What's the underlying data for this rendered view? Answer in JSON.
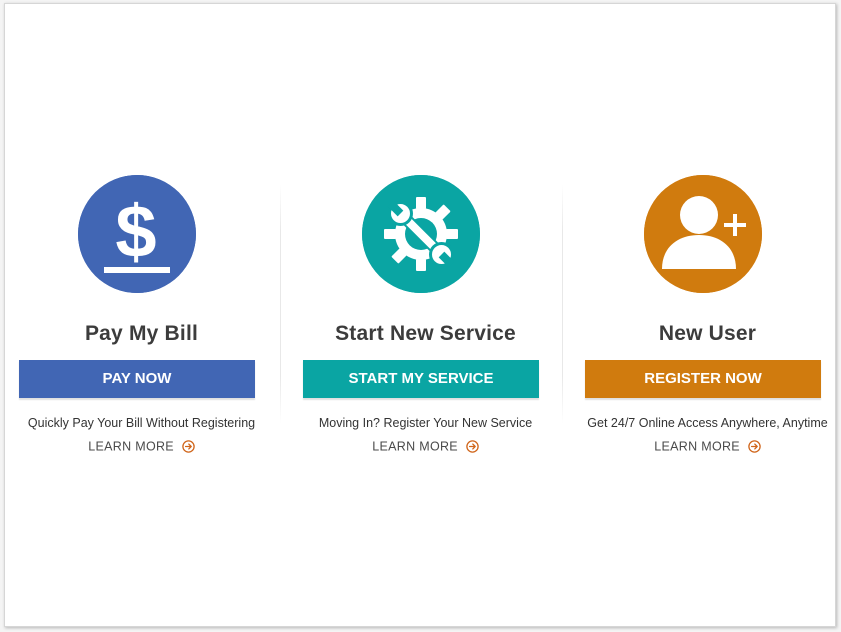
{
  "cards": [
    {
      "title": "Pay My Bill",
      "button_label": "PAY NOW",
      "description": "Quickly Pay Your Bill Without Registering",
      "link_label": "LEARN MORE",
      "icon": "dollar-icon",
      "color": "#4166b4"
    },
    {
      "title": "Start New Service",
      "button_label": "START MY SERVICE",
      "description": "Moving In? Register Your New Service",
      "link_label": "LEARN MORE",
      "icon": "gear-wrench-icon",
      "color": "#0aa5a3"
    },
    {
      "title": "New User",
      "button_label": "REGISTER NOW",
      "description": "Get 24/7 Online Access Anywhere, Anytime",
      "link_label": "LEARN MORE",
      "icon": "add-user-icon",
      "color": "#d07b0e"
    }
  ],
  "colors": {
    "link_arrow": "#d0651a",
    "title_text": "#3c3c3c",
    "body_text": "#333333"
  }
}
